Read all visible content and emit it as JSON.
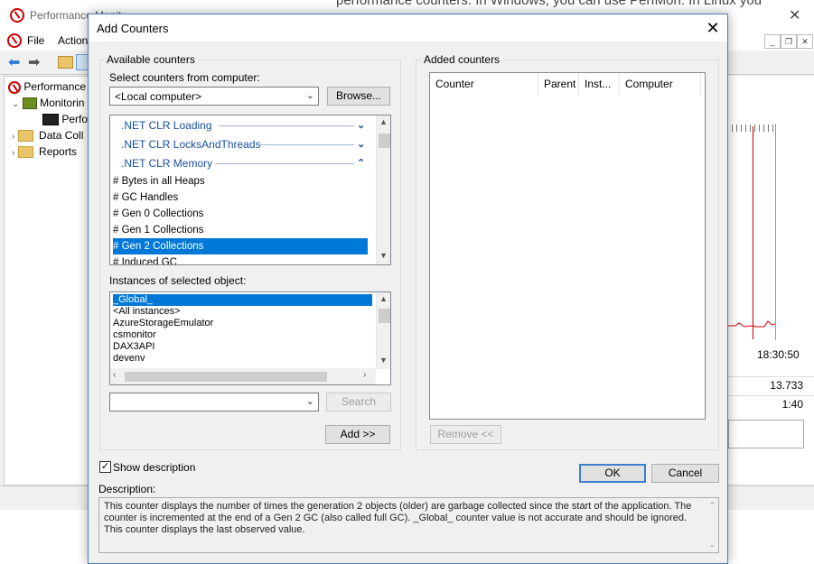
{
  "background_window": {
    "title": "Performance Monit",
    "overlay_text": "performance counters. In Windows, you can use PerfMon. In Linux you",
    "menu": [
      "File",
      "Action"
    ],
    "tree": {
      "root": "Performance",
      "monitoring": "Monitorin",
      "perfmon": "Perfo",
      "data_collector": "Data Coll",
      "reports": "Reports"
    },
    "time_label": "18:30:50",
    "stat_value_1": "13.733",
    "stat_value_2": "1:40"
  },
  "dialog": {
    "title": "Add Counters",
    "available_group_label": "Available counters",
    "select_computer_label": "Select counters from computer:",
    "computer_value": "<Local computer>",
    "browse_button": "Browse...",
    "objects": [
      {
        "label": ".NET CLR Loading",
        "expanded": false
      },
      {
        "label": ".NET CLR LocksAndThreads",
        "expanded": false
      },
      {
        "label": ".NET CLR Memory",
        "expanded": true
      }
    ],
    "counters": [
      "# Bytes in all Heaps",
      "# GC Handles",
      "# Gen 0 Collections",
      "# Gen 1 Collections",
      "# Gen 2 Collections",
      "# Induced GC"
    ],
    "selected_counter": "# Gen 2 Collections",
    "instances_label": "Instances of selected object:",
    "instances": [
      "_Global_",
      "<All instances>",
      "AzureStorageEmulator",
      "csmonitor",
      "DAX3API",
      "devenv"
    ],
    "selected_instance": "_Global_",
    "search_value": "",
    "search_button": "Search",
    "add_button": "Add >>",
    "added_group_label": "Added counters",
    "added_columns": [
      "Counter",
      "Parent",
      "Inst...",
      "Computer"
    ],
    "remove_button": "Remove <<",
    "show_description_label": "Show description",
    "show_description_checked": true,
    "ok_button": "OK",
    "cancel_button": "Cancel",
    "description_label": "Description:",
    "description_text": "This counter displays the number of times the generation 2 objects (older) are garbage collected since the start of the application. The counter is incremented at the end of a Gen 2 GC (also called full GC). _Global_ counter value is not accurate and should be ignored. This counter displays the last observed value."
  },
  "colors": {
    "selection": "#0078d7",
    "object_text": "#1a4fa0",
    "default_button_border": "#3c7fd0",
    "perf_icon": "#cc0000"
  }
}
